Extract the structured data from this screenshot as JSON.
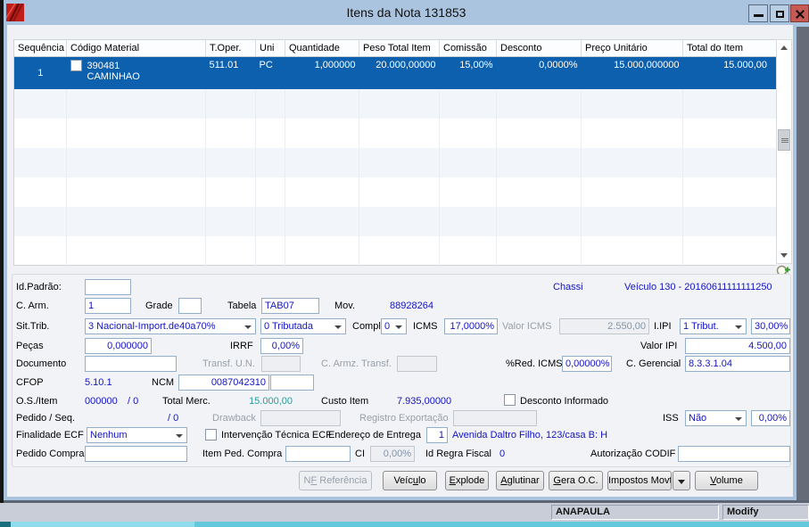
{
  "window": {
    "title": "Itens da Nota 131853"
  },
  "icons": {
    "app": "red-diagonal-logo",
    "minimize": "minus-bar",
    "maximize": "square-outline",
    "close": "x-cross",
    "zoom": "magnifier-plus",
    "select_chevron": "chevron-down",
    "scroll_up": "triangle-up",
    "scroll_down": "triangle-down",
    "more": "triangle-down"
  },
  "table": {
    "columns": [
      "Sequência",
      "Código Material",
      "T.Oper.",
      "Uni",
      "Quantidade",
      "Peso Total Item",
      "Comissão",
      "Desconto",
      "Preço Unitário",
      "Total do Item"
    ],
    "row": {
      "seq": "1",
      "codigo": "390481",
      "descricao": "CAMINHAO",
      "toper": "511.01",
      "uni": "PC",
      "quantidade": "1,000000",
      "peso_total": "20.000,00000",
      "comissao": "15,00%",
      "desconto": "0,0000%",
      "preco_unitario": "15.000,000000",
      "total_item": "15.000,00",
      "checked": false
    }
  },
  "form": {
    "id_padrao": {
      "label": "Id.Padrão:",
      "value": ""
    },
    "chassi": {
      "label": "Chassi",
      "value": "Veículo 130 - 20160611111111250"
    },
    "c_arm": {
      "label": "C. Arm.",
      "value": "1"
    },
    "grade": {
      "label": "Grade",
      "value": ""
    },
    "tabela": {
      "label": "Tabela",
      "value": "TAB07"
    },
    "mov": {
      "label": "Mov.",
      "value": "88928264"
    },
    "sit_trib": {
      "label": "Sit.Trib.",
      "value": "3 Nacional-Import.de40a70%"
    },
    "tributacao": {
      "value": "0 Tributada"
    },
    "compl": {
      "label": "Compl",
      "value": "0"
    },
    "icms": {
      "label": "ICMS",
      "value": "17,0000%"
    },
    "valor_icms": {
      "label": "Valor ICMS",
      "value": "2.550,00"
    },
    "iipi": {
      "label": "I.IPI",
      "value": "1 Tribut.",
      "pct": "30,00%"
    },
    "pecas": {
      "label": "Peças",
      "value": "0,000000"
    },
    "irrf": {
      "label": "IRRF",
      "value": "0,00%"
    },
    "valor_ipi": {
      "label": "Valor IPI",
      "value": "4.500,00"
    },
    "documento": {
      "label": "Documento",
      "value": ""
    },
    "transf_un": {
      "label": "Transf. U.N.",
      "value": ""
    },
    "c_armz_transf": {
      "label": "C. Armz. Transf.",
      "value": ""
    },
    "red_icms": {
      "label": "%Red. ICMS",
      "value": "0,00000%"
    },
    "c_gerencial": {
      "label": "C. Gerencial",
      "value": "8.3.3.1.04"
    },
    "cfop": {
      "label": "CFOP",
      "value": "5.10.1"
    },
    "ncm": {
      "label": "NCM",
      "value": "0087042310",
      "extra": ""
    },
    "os_item": {
      "label": "O.S./Item",
      "value": "000000",
      "seq": "/ 0"
    },
    "total_merc": {
      "label": "Total Merc.",
      "value": "15.000,00"
    },
    "custo_item": {
      "label": "Custo Item",
      "value": "7.935,00000"
    },
    "desconto_informado": {
      "label": "Desconto Informado",
      "checked": false
    },
    "pedido_seq": {
      "label": "Pedido / Seq.",
      "value": "/ 0"
    },
    "drawback": {
      "label": "Drawback",
      "value": ""
    },
    "registro_exportacao": {
      "label": "Registro Exportação",
      "value": ""
    },
    "iss": {
      "label": "ISS",
      "value": "Não",
      "pct": "0,00%"
    },
    "finalidade_ecf": {
      "label": "Finalidade ECF",
      "value": "Nenhum"
    },
    "intervencao_ecf": {
      "label": "Intervenção Técnica ECF",
      "checked": false
    },
    "endereco_entrega": {
      "label": "Endereço de Entrega",
      "num": "1",
      "address": "Avenida Daltro Filho, 123/casa B: H"
    },
    "pedido_compra": {
      "label": "Pedido Compra",
      "value": ""
    },
    "item_ped_compra": {
      "label": "Item Ped. Compra",
      "value": ""
    },
    "ci": {
      "label": "CI",
      "value": "0,00%"
    },
    "id_regra_fiscal": {
      "label": "Id Regra Fiscal",
      "value": "0"
    },
    "autorizacao_codif": {
      "label": "Autorização CODIF",
      "value": ""
    }
  },
  "buttons": {
    "nf_referencia": {
      "pre": "N",
      "u": "F",
      "post": " Referência",
      "disabled": true
    },
    "veiculo": {
      "pre": "Veíc",
      "u": "u",
      "post": "lo"
    },
    "explode": {
      "pre": "",
      "u": "E",
      "post": "xplode"
    },
    "aglutinar": {
      "pre": "",
      "u": "A",
      "post": "glutinar"
    },
    "gera_oc": {
      "pre": "",
      "u": "G",
      "post": "era O.C."
    },
    "impostos_movto": {
      "pre": "Impostos Movto",
      "u": "",
      "post": ""
    },
    "volume": {
      "pre": "",
      "u": "V",
      "post": "olume"
    }
  },
  "statusbar": {
    "user": "ANAPAULA",
    "mode": "Modify"
  },
  "colors": {
    "titlebar": "#aac4df",
    "selected_row": "#0c60ae",
    "value_blue": "#1414c0",
    "total_merc_teal": "#2a9b9b",
    "close_button": "#c75a55",
    "status_cyan": "#62c8dc"
  }
}
